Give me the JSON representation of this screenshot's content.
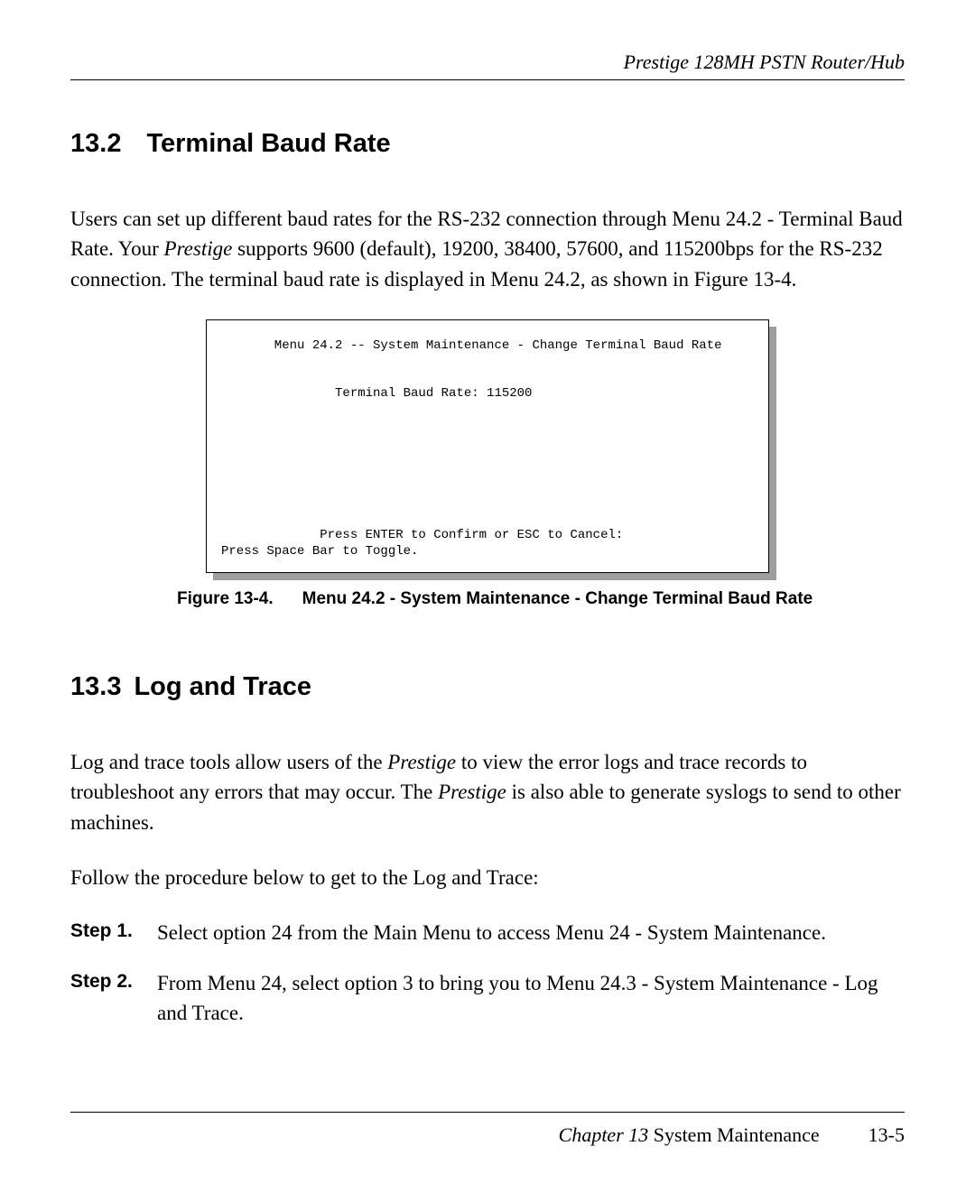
{
  "header": {
    "running_head": "Prestige 128MH    PSTN Router/Hub"
  },
  "section_132": {
    "number": "13.2",
    "title": "Terminal Baud Rate",
    "para1_a": "Users can set up different baud rates for the RS-232 connection through Menu 24.2 - Terminal Baud Rate. Your ",
    "para1_prestige": "Prestige",
    "para1_b": " supports 9600 (default), 19200, 38400, 57600, and 115200bps for the RS-232 connection. The terminal baud rate is displayed in Menu 24.2, as shown in Figure 13-4."
  },
  "terminal": {
    "line_title": "       Menu 24.2 -- System Maintenance - Change Terminal Baud Rate",
    "line_value": "               Terminal Baud Rate: 115200",
    "line_confirm": "             Press ENTER to Confirm or ESC to Cancel:",
    "line_toggle": "Press Space Bar to Toggle."
  },
  "figure_caption": {
    "label": "Figure 13-4.",
    "text": "Menu 24.2 - System Maintenance - Change Terminal Baud Rate"
  },
  "section_133": {
    "number": "13.3",
    "title": "Log and Trace",
    "para1_a": "Log and trace tools allow users of the ",
    "para1_prestige": "Prestige",
    "para1_b": " to view the error logs and trace records to troubleshoot any errors that may occur. The ",
    "para1_prestige2": "Prestige",
    "para1_c": " is also able to generate syslogs to send to other machines.",
    "para2": "Follow the procedure below to get to the Log and Trace:"
  },
  "steps": [
    {
      "label": "Step 1.",
      "text": "Select option 24 from the Main Menu to access Menu 24 - System Maintenance."
    },
    {
      "label": "Step 2.",
      "text": "From Menu 24, select option 3 to bring you to Menu 24.3 - System Maintenance - Log and Trace."
    }
  ],
  "footer": {
    "chapter_prefix": "Chapter 13 ",
    "chapter_title": "System Maintenance",
    "page_number": "13-5"
  }
}
